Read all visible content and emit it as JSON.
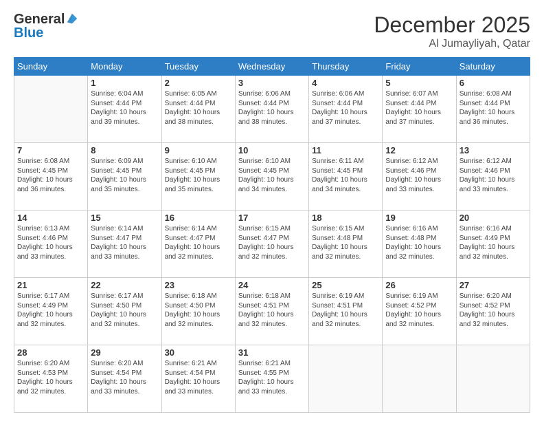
{
  "header": {
    "logo_general": "General",
    "logo_blue": "Blue",
    "month_title": "December 2025",
    "location": "Al Jumayliyah, Qatar"
  },
  "weekdays": [
    "Sunday",
    "Monday",
    "Tuesday",
    "Wednesday",
    "Thursday",
    "Friday",
    "Saturday"
  ],
  "weeks": [
    [
      {
        "day": "",
        "info": ""
      },
      {
        "day": "1",
        "info": "Sunrise: 6:04 AM\nSunset: 4:44 PM\nDaylight: 10 hours\nand 39 minutes."
      },
      {
        "day": "2",
        "info": "Sunrise: 6:05 AM\nSunset: 4:44 PM\nDaylight: 10 hours\nand 38 minutes."
      },
      {
        "day": "3",
        "info": "Sunrise: 6:06 AM\nSunset: 4:44 PM\nDaylight: 10 hours\nand 38 minutes."
      },
      {
        "day": "4",
        "info": "Sunrise: 6:06 AM\nSunset: 4:44 PM\nDaylight: 10 hours\nand 37 minutes."
      },
      {
        "day": "5",
        "info": "Sunrise: 6:07 AM\nSunset: 4:44 PM\nDaylight: 10 hours\nand 37 minutes."
      },
      {
        "day": "6",
        "info": "Sunrise: 6:08 AM\nSunset: 4:44 PM\nDaylight: 10 hours\nand 36 minutes."
      }
    ],
    [
      {
        "day": "7",
        "info": "Sunrise: 6:08 AM\nSunset: 4:45 PM\nDaylight: 10 hours\nand 36 minutes."
      },
      {
        "day": "8",
        "info": "Sunrise: 6:09 AM\nSunset: 4:45 PM\nDaylight: 10 hours\nand 35 minutes."
      },
      {
        "day": "9",
        "info": "Sunrise: 6:10 AM\nSunset: 4:45 PM\nDaylight: 10 hours\nand 35 minutes."
      },
      {
        "day": "10",
        "info": "Sunrise: 6:10 AM\nSunset: 4:45 PM\nDaylight: 10 hours\nand 34 minutes."
      },
      {
        "day": "11",
        "info": "Sunrise: 6:11 AM\nSunset: 4:45 PM\nDaylight: 10 hours\nand 34 minutes."
      },
      {
        "day": "12",
        "info": "Sunrise: 6:12 AM\nSunset: 4:46 PM\nDaylight: 10 hours\nand 33 minutes."
      },
      {
        "day": "13",
        "info": "Sunrise: 6:12 AM\nSunset: 4:46 PM\nDaylight: 10 hours\nand 33 minutes."
      }
    ],
    [
      {
        "day": "14",
        "info": "Sunrise: 6:13 AM\nSunset: 4:46 PM\nDaylight: 10 hours\nand 33 minutes."
      },
      {
        "day": "15",
        "info": "Sunrise: 6:14 AM\nSunset: 4:47 PM\nDaylight: 10 hours\nand 33 minutes."
      },
      {
        "day": "16",
        "info": "Sunrise: 6:14 AM\nSunset: 4:47 PM\nDaylight: 10 hours\nand 32 minutes."
      },
      {
        "day": "17",
        "info": "Sunrise: 6:15 AM\nSunset: 4:47 PM\nDaylight: 10 hours\nand 32 minutes."
      },
      {
        "day": "18",
        "info": "Sunrise: 6:15 AM\nSunset: 4:48 PM\nDaylight: 10 hours\nand 32 minutes."
      },
      {
        "day": "19",
        "info": "Sunrise: 6:16 AM\nSunset: 4:48 PM\nDaylight: 10 hours\nand 32 minutes."
      },
      {
        "day": "20",
        "info": "Sunrise: 6:16 AM\nSunset: 4:49 PM\nDaylight: 10 hours\nand 32 minutes."
      }
    ],
    [
      {
        "day": "21",
        "info": "Sunrise: 6:17 AM\nSunset: 4:49 PM\nDaylight: 10 hours\nand 32 minutes."
      },
      {
        "day": "22",
        "info": "Sunrise: 6:17 AM\nSunset: 4:50 PM\nDaylight: 10 hours\nand 32 minutes."
      },
      {
        "day": "23",
        "info": "Sunrise: 6:18 AM\nSunset: 4:50 PM\nDaylight: 10 hours\nand 32 minutes."
      },
      {
        "day": "24",
        "info": "Sunrise: 6:18 AM\nSunset: 4:51 PM\nDaylight: 10 hours\nand 32 minutes."
      },
      {
        "day": "25",
        "info": "Sunrise: 6:19 AM\nSunset: 4:51 PM\nDaylight: 10 hours\nand 32 minutes."
      },
      {
        "day": "26",
        "info": "Sunrise: 6:19 AM\nSunset: 4:52 PM\nDaylight: 10 hours\nand 32 minutes."
      },
      {
        "day": "27",
        "info": "Sunrise: 6:20 AM\nSunset: 4:52 PM\nDaylight: 10 hours\nand 32 minutes."
      }
    ],
    [
      {
        "day": "28",
        "info": "Sunrise: 6:20 AM\nSunset: 4:53 PM\nDaylight: 10 hours\nand 32 minutes."
      },
      {
        "day": "29",
        "info": "Sunrise: 6:20 AM\nSunset: 4:54 PM\nDaylight: 10 hours\nand 33 minutes."
      },
      {
        "day": "30",
        "info": "Sunrise: 6:21 AM\nSunset: 4:54 PM\nDaylight: 10 hours\nand 33 minutes."
      },
      {
        "day": "31",
        "info": "Sunrise: 6:21 AM\nSunset: 4:55 PM\nDaylight: 10 hours\nand 33 minutes."
      },
      {
        "day": "",
        "info": ""
      },
      {
        "day": "",
        "info": ""
      },
      {
        "day": "",
        "info": ""
      }
    ]
  ]
}
